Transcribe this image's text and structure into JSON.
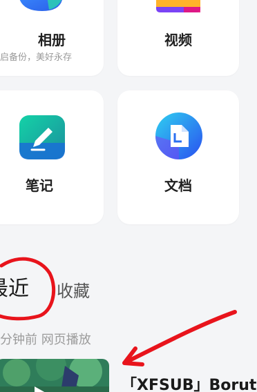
{
  "cards": {
    "album": {
      "title": "相册",
      "subtitle": "启备份，美好永存"
    },
    "video": {
      "title": "视频"
    },
    "notes": {
      "title": "笔记"
    },
    "docs": {
      "title": "文档"
    }
  },
  "tabs": {
    "recent": "最近",
    "favorites": "收藏"
  },
  "recent_item": {
    "meta": "分钟前 网页播放",
    "title": "「XFSUB」Boruto"
  },
  "annotation_colors": {
    "circle": "#e8141c",
    "arrow": "#e8141c"
  },
  "icon_names": [
    "album-icon",
    "video-icon",
    "notes-icon",
    "document-icon",
    "play-icon"
  ]
}
